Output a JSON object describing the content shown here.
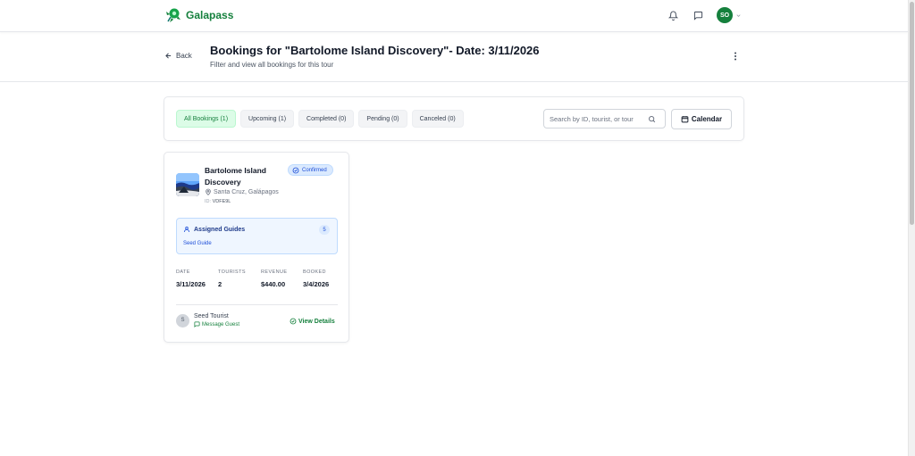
{
  "app": {
    "name": "Galapass",
    "user_initials": "SO"
  },
  "header": {
    "back_label": "Back",
    "title": "Bookings for \"Bartolome Island Discovery\"- Date: 3/11/2026",
    "subtitle": "Filter and view all bookings for this tour"
  },
  "filters": {
    "tabs": [
      {
        "label": "All Bookings (1)",
        "active": true
      },
      {
        "label": "Upcoming (1)",
        "active": false
      },
      {
        "label": "Completed (0)",
        "active": false
      },
      {
        "label": "Pending (0)",
        "active": false
      },
      {
        "label": "Canceled (0)",
        "active": false
      }
    ],
    "search_placeholder": "Search by ID, tourist, or tour",
    "calendar_label": "Calendar"
  },
  "booking": {
    "tour_name": "Bartolome Island Discovery",
    "status": "Confirmed",
    "location": "Santa Cruz, Galápagos",
    "id_label": "ID:",
    "id_value": "VDFE9L",
    "guides": {
      "title": "Assigned Guides",
      "count": "5",
      "guide_name": "Seed Guide"
    },
    "stats": [
      {
        "label": "DATE",
        "value": "3/11/2026"
      },
      {
        "label": "TOURISTS",
        "value": "2"
      },
      {
        "label": "REVENUE",
        "value": "$440.00"
      },
      {
        "label": "BOOKED",
        "value": "3/4/2026"
      }
    ],
    "guest": {
      "initial": "S",
      "name": "Seed Tourist",
      "message_label": "Message Guest"
    },
    "view_details_label": "View Details"
  },
  "colors": {
    "brand": "#15803d",
    "confirmed": "#1d4ed8"
  }
}
